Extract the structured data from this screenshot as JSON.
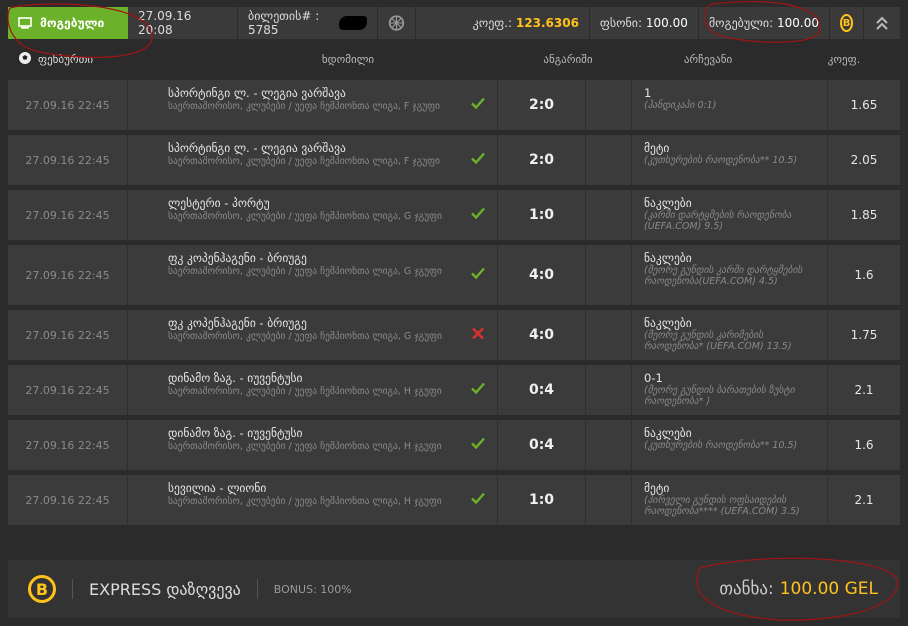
{
  "topbar": {
    "won_label": "მოგებული",
    "date": "27.09.16 20:08",
    "ticket_label": "ბილეთის# : 5785",
    "coef_label": "კოეფ.:",
    "coef_value": "123.6306",
    "bet_label": "ფსონი:",
    "bet_value": "100.00",
    "win_label": "მოგებული:",
    "win_value": "100.00",
    "coin_letter": "B"
  },
  "header": {
    "sport": "ფეხბურთი",
    "event": "ხდომილი",
    "score": "ანგარიში",
    "choice": "არჩევანი",
    "coef": "კოეფ."
  },
  "rows": [
    {
      "date": "27.09.16 22:45",
      "title": "სპორტინგი ლ. - ლეგია ვარშავა",
      "league": "საერთაშორისო, კლუბები / უეფა ჩემპიონთა ლიგა, F ჯგუფი",
      "status": "won",
      "score": "2:0",
      "pick": "1",
      "detail": "(ჰანდიკაპი 0:1)",
      "coef": "1.65"
    },
    {
      "date": "27.09.16 22:45",
      "title": "სპორტინგი ლ. - ლეგია ვარშავა",
      "league": "საერთაშორისო, კლუბები / უეფა ჩემპიონთა ლიგა, F ჯგუფი",
      "status": "won",
      "score": "2:0",
      "pick": "მეტი",
      "detail": "(კუთხურების რაოდენობა** 10.5)",
      "coef": "2.05"
    },
    {
      "date": "27.09.16 22:45",
      "title": "ლესტერი - პორტუ",
      "league": "საერთაშორისო, კლუბები / უეფა ჩემპიონთა ლიგა, G ჯგუფი",
      "status": "won",
      "score": "1:0",
      "pick": "ნაკლები",
      "detail": "(კარში დარტყმების რაოდენობა (UEFA.COM) 9.5)",
      "coef": "1.85"
    },
    {
      "date": "27.09.16 22:45",
      "title": "ფკ კოპენჰაგენი - ბრიუგე",
      "league": "საერთაშორისო, კლუბები / უეფა ჩემპიონთა ლიგა, G ჯგუფი",
      "status": "won",
      "score": "4:0",
      "pick": "ნაკლები",
      "detail": "(მეორე გუნდის კარში დარტყმების რაოდენობა(UEFA.COM) 4.5)",
      "coef": "1.6"
    },
    {
      "date": "27.09.16 22:45",
      "title": "ფკ კოპენჰაგენი - ბრიუგე",
      "league": "საერთაშორისო, კლუბები / უეფა ჩემპიონთა ლიგა, G ჯგუფი",
      "status": "lost",
      "score": "4:0",
      "pick": "ნაკლები",
      "detail": "(მეორე გუნდის კარიმების რაოდენობა* (UEFA.COM) 13.5)",
      "coef": "1.75"
    },
    {
      "date": "27.09.16 22:45",
      "title": "დინამო ზაგ. - იუვენტუსი",
      "league": "საერთაშორისო, კლუბები / უეფა ჩემპიონთა ლიგა, H ჯგუფი",
      "status": "won",
      "score": "0:4",
      "pick": "0-1",
      "detail": "(მეორე გუნდის ბარათების ზუსტი რაოდენობა* )",
      "coef": "2.1"
    },
    {
      "date": "27.09.16 22:45",
      "title": "დინამო ზაგ. - იუვენტუსი",
      "league": "საერთაშორისო, კლუბები / უეფა ჩემპიონთა ლიგა, H ჯგუფი",
      "status": "won",
      "score": "0:4",
      "pick": "ნაკლები",
      "detail": "(კუთხურების რაოდენობა** 10.5)",
      "coef": "1.6"
    },
    {
      "date": "27.09.16 22:45",
      "title": "სევილია - ლიონი",
      "league": "საერთაშორისო, კლუბები / უეფა ჩემპიონთა ლიგა, H ჯგუფი",
      "status": "won",
      "score": "1:0",
      "pick": "მეტი",
      "detail": "(პირველი გუნდის ოფსაიდების რაოდენობა**** (UEFA.COM) 3.5)",
      "coef": "2.1"
    }
  ],
  "footer": {
    "coin_letter": "B",
    "express_label": "EXPRESS დაზღვევა",
    "bonus_label": "BONUS: 100%",
    "sum_label": "თანხა:",
    "sum_value": "100.00 GEL"
  },
  "colors": {
    "accent_green": "#6cb12a",
    "accent_gold": "#ffc21a",
    "lost_red": "#d9302b",
    "row_bg": "#3b3b3b",
    "annotation": "#a01414"
  }
}
